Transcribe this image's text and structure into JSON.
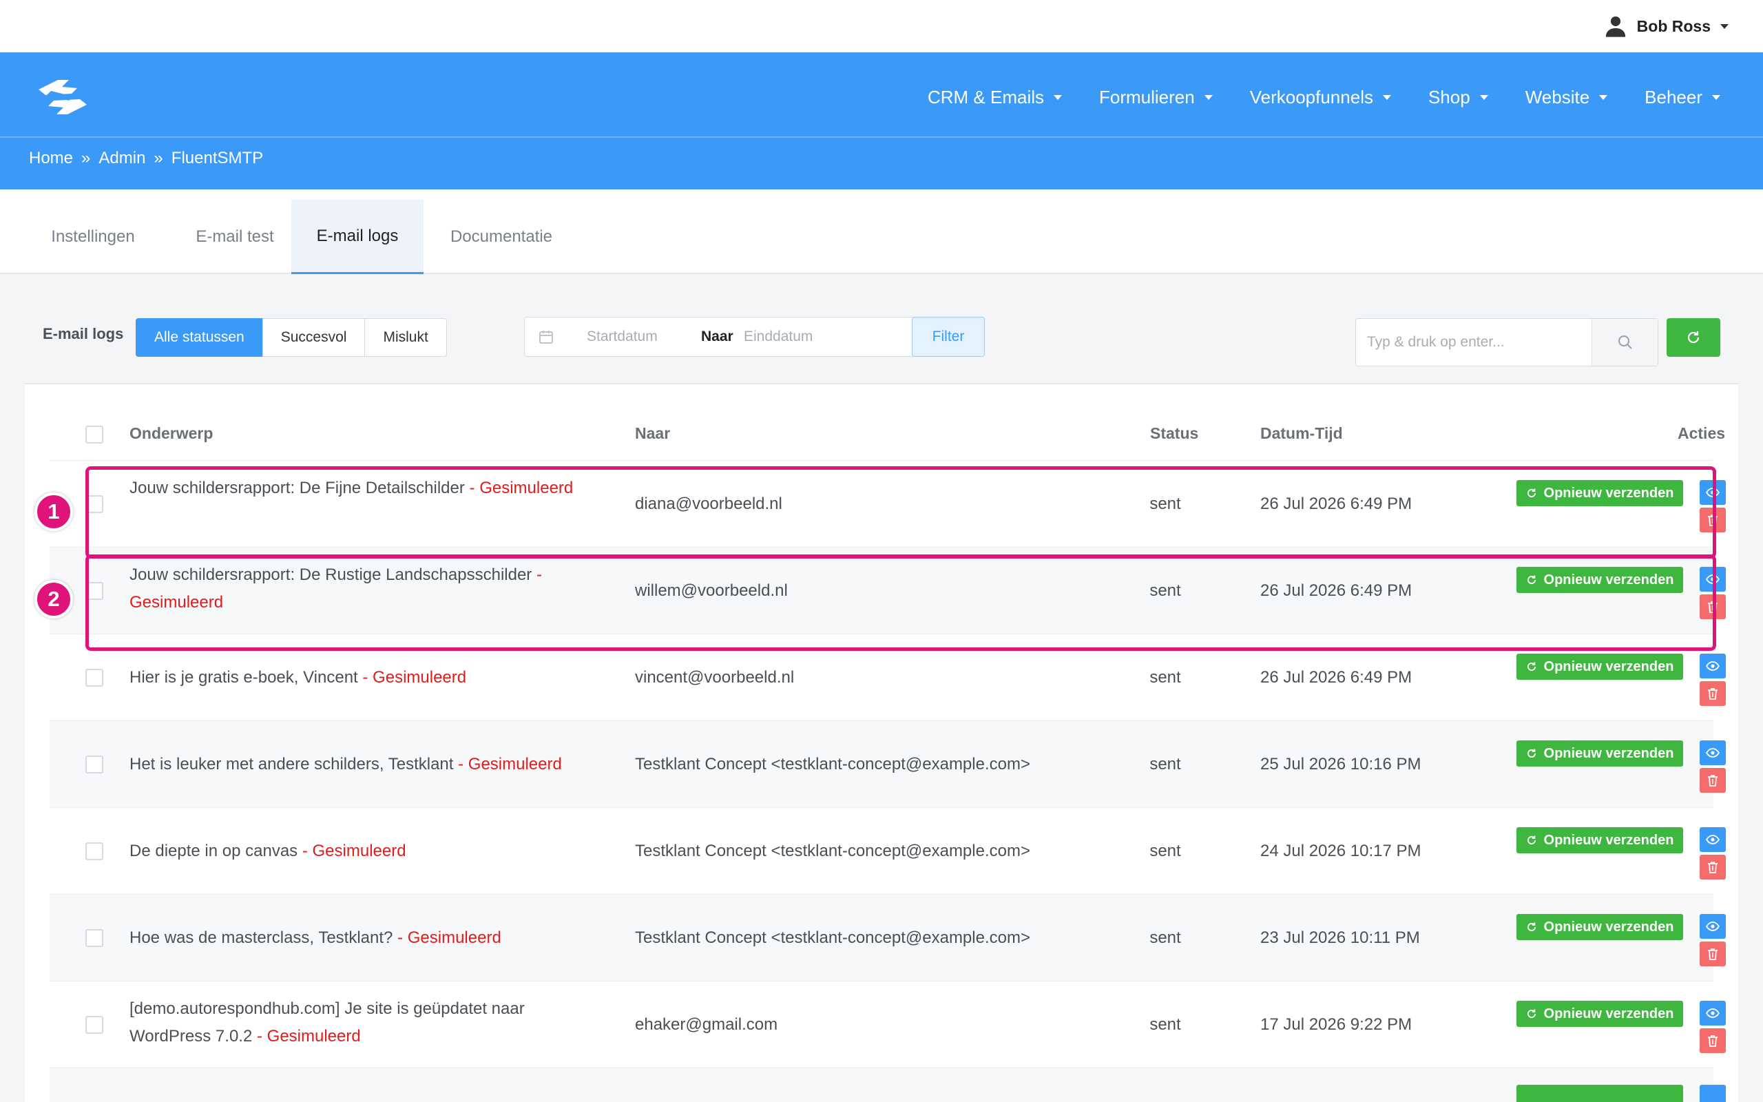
{
  "user": {
    "name": "Bob Ross"
  },
  "nav": {
    "items": [
      {
        "label": "CRM & Emails"
      },
      {
        "label": "Formulieren"
      },
      {
        "label": "Verkoopfunnels"
      },
      {
        "label": "Shop"
      },
      {
        "label": "Website"
      },
      {
        "label": "Beheer"
      }
    ]
  },
  "breadcrumb": {
    "home": "Home",
    "sep": "»",
    "admin": "Admin",
    "current": "FluentSMTP"
  },
  "tabs": [
    {
      "label": "Instellingen"
    },
    {
      "label": "E-mail test"
    },
    {
      "label": "E-mail logs"
    },
    {
      "label": "Documentatie"
    }
  ],
  "toolbar": {
    "label": "E-mail logs",
    "statuses": [
      "Alle statussen",
      "Succesvol",
      "Mislukt"
    ],
    "start_placeholder": "Startdatum",
    "range_separator": "Naar",
    "end_placeholder": "Einddatum",
    "filter_label": "Filter",
    "search_placeholder": "Typ & druk op enter..."
  },
  "table": {
    "headers": {
      "subject": "Onderwerp",
      "to": "Naar",
      "status": "Status",
      "datetime": "Datum-Tijd",
      "actions": "Acties"
    },
    "resend_label": "Opnieuw verzenden",
    "simulated_suffix": "- Gesimuleerd",
    "rows": [
      {
        "subject": "Jouw schildersrapport: De Fijne Detailschilder",
        "to": "diana@voorbeeld.nl",
        "status": "sent",
        "datetime": "26 Jul 2026 6:49 PM"
      },
      {
        "subject": "Jouw schildersrapport: De Rustige Landschapsschilder",
        "to": "willem@voorbeeld.nl",
        "status": "sent",
        "datetime": "26 Jul 2026 6:49 PM"
      },
      {
        "subject": "Hier is je gratis e-boek, Vincent",
        "to": "vincent@voorbeeld.nl",
        "status": "sent",
        "datetime": "26 Jul 2026 6:49 PM"
      },
      {
        "subject": "Het is leuker met andere schilders, Testklant",
        "to": "Testklant Concept <testklant-concept@example.com>",
        "status": "sent",
        "datetime": "25 Jul 2026 10:16 PM"
      },
      {
        "subject": "De diepte in op canvas",
        "to": "Testklant Concept <testklant-concept@example.com>",
        "status": "sent",
        "datetime": "24 Jul 2026 10:17 PM"
      },
      {
        "subject": "Hoe was de masterclass, Testklant?",
        "to": "Testklant Concept <testklant-concept@example.com>",
        "status": "sent",
        "datetime": "23 Jul 2026 10:11 PM"
      },
      {
        "subject": "[demo.autorespondhub.com] Je site is geüpdatet naar WordPress 7.0.2",
        "to": "ehaker@gmail.com",
        "status": "sent",
        "datetime": "17 Jul 2026 9:22 PM"
      }
    ]
  },
  "annotations": [
    "1",
    "2"
  ],
  "colors": {
    "primary": "#3b99f7",
    "success": "#3fb63f",
    "danger": "#f56c6c",
    "simulated": "#e31b1b",
    "highlight": "#e0137a"
  }
}
